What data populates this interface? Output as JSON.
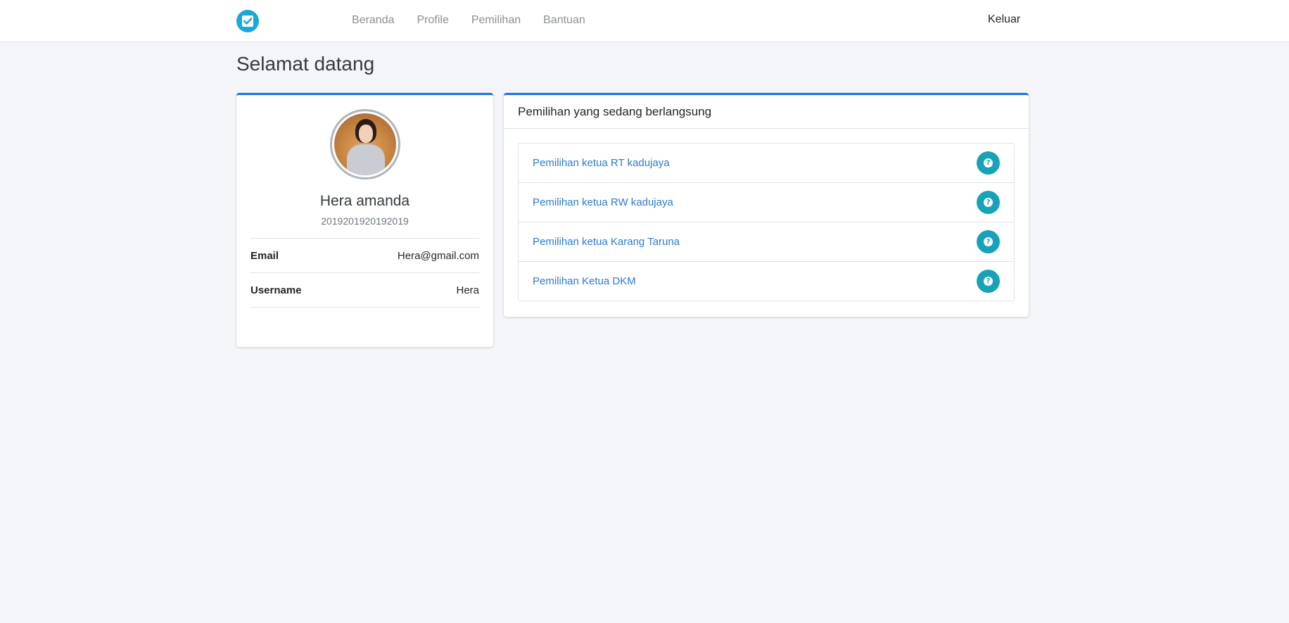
{
  "nav": {
    "brand_icon": "check-square-icon",
    "links": [
      "Beranda",
      "Profile",
      "Pemilihan",
      "Bantuan"
    ],
    "logout": "Keluar"
  },
  "page": {
    "title": "Selamat datang"
  },
  "profile": {
    "avatar": "user-photo",
    "name": "Hera amanda",
    "id_number": "2019201920192019",
    "fields": [
      {
        "label": "Email",
        "value": "Hera@gmail.com"
      },
      {
        "label": "Username",
        "value": "Hera"
      }
    ]
  },
  "elections": {
    "header": "Pemilihan yang sedang berlangsung",
    "items": [
      {
        "title": "Pemilihan ketua RT kadujaya",
        "icon": "question-circle-icon"
      },
      {
        "title": "Pemilihan ketua RW kadujaya",
        "icon": "question-circle-icon"
      },
      {
        "title": "Pemilihan ketua Karang Taruna",
        "icon": "question-circle-icon"
      },
      {
        "title": "Pemilihan Ketua DKM",
        "icon": "question-circle-icon"
      }
    ]
  },
  "colors": {
    "accent": "#1a73e8",
    "brand": "#1aa8d8",
    "help_button": "#17a2b8",
    "link": "#2a7bd5",
    "background": "#f3f5f9"
  }
}
